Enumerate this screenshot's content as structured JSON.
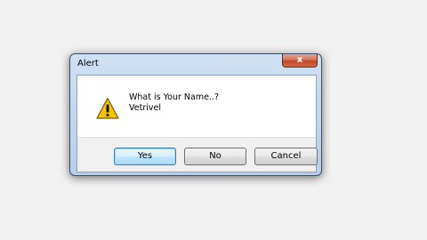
{
  "window": {
    "title": "Alert",
    "close_label": "x"
  },
  "message": {
    "icon": "warning-icon",
    "line1": "What is Your Name..?",
    "line2": "Vetrivel"
  },
  "buttons": {
    "yes": "Yes",
    "no": "No",
    "cancel": "Cancel"
  },
  "colors": {
    "desktop": "#f1f1f1",
    "frame": "#b7cfe8",
    "close": "#c1462a",
    "warning": "#f5c400"
  }
}
